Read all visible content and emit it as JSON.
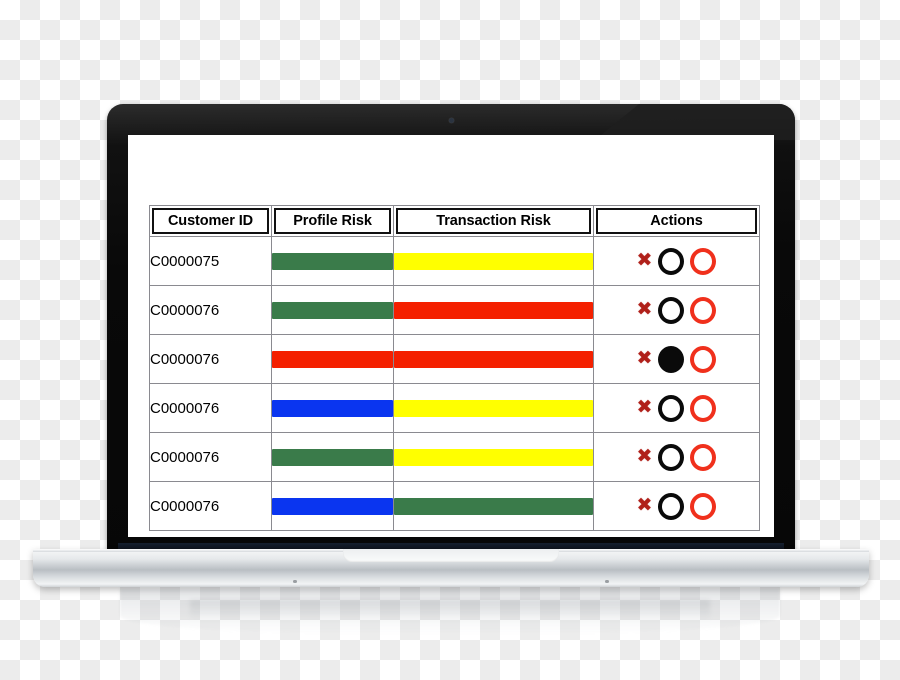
{
  "device": {
    "type": "laptop",
    "webcam_icon": "webcam-dot"
  },
  "table": {
    "columns": [
      {
        "key": "customer_id",
        "label": "Customer ID"
      },
      {
        "key": "profile_risk",
        "label": "Profile Risk"
      },
      {
        "key": "transaction_risk",
        "label": "Transaction Risk"
      },
      {
        "key": "actions",
        "label": "Actions"
      }
    ],
    "rows": [
      {
        "customer_id": "C0000075",
        "profile_risk": "green",
        "transaction_risk": "yellow",
        "actions": {
          "delete_icon": "x-icon",
          "black_circle": "ring",
          "red_circle": "ring"
        }
      },
      {
        "customer_id": "C0000076",
        "profile_risk": "green",
        "transaction_risk": "red",
        "actions": {
          "delete_icon": "x-icon",
          "black_circle": "ring",
          "red_circle": "ring"
        }
      },
      {
        "customer_id": "C0000076",
        "profile_risk": "red",
        "transaction_risk": "red",
        "actions": {
          "delete_icon": "x-icon",
          "black_circle": "filled",
          "red_circle": "ring"
        }
      },
      {
        "customer_id": "C0000076",
        "profile_risk": "blue",
        "transaction_risk": "yellow",
        "actions": {
          "delete_icon": "x-icon",
          "black_circle": "ring",
          "red_circle": "ring"
        }
      },
      {
        "customer_id": "C0000076",
        "profile_risk": "green",
        "transaction_risk": "yellow",
        "actions": {
          "delete_icon": "x-icon",
          "black_circle": "ring",
          "red_circle": "ring"
        }
      },
      {
        "customer_id": "C0000076",
        "profile_risk": "blue",
        "transaction_risk": "green",
        "actions": {
          "delete_icon": "x-icon",
          "black_circle": "ring",
          "red_circle": "ring"
        }
      }
    ]
  },
  "colors": {
    "green": "#3a7b4a",
    "red": "#f42000",
    "yellow": "#ffff00",
    "blue": "#0a35f0",
    "black": "#0a0a0a",
    "ring_red": "#f0301c",
    "x_mark": "#b0201a",
    "table_border": "#8a8a90",
    "header_border": "#111111"
  },
  "glyphs": {
    "x_mark": "✖"
  }
}
